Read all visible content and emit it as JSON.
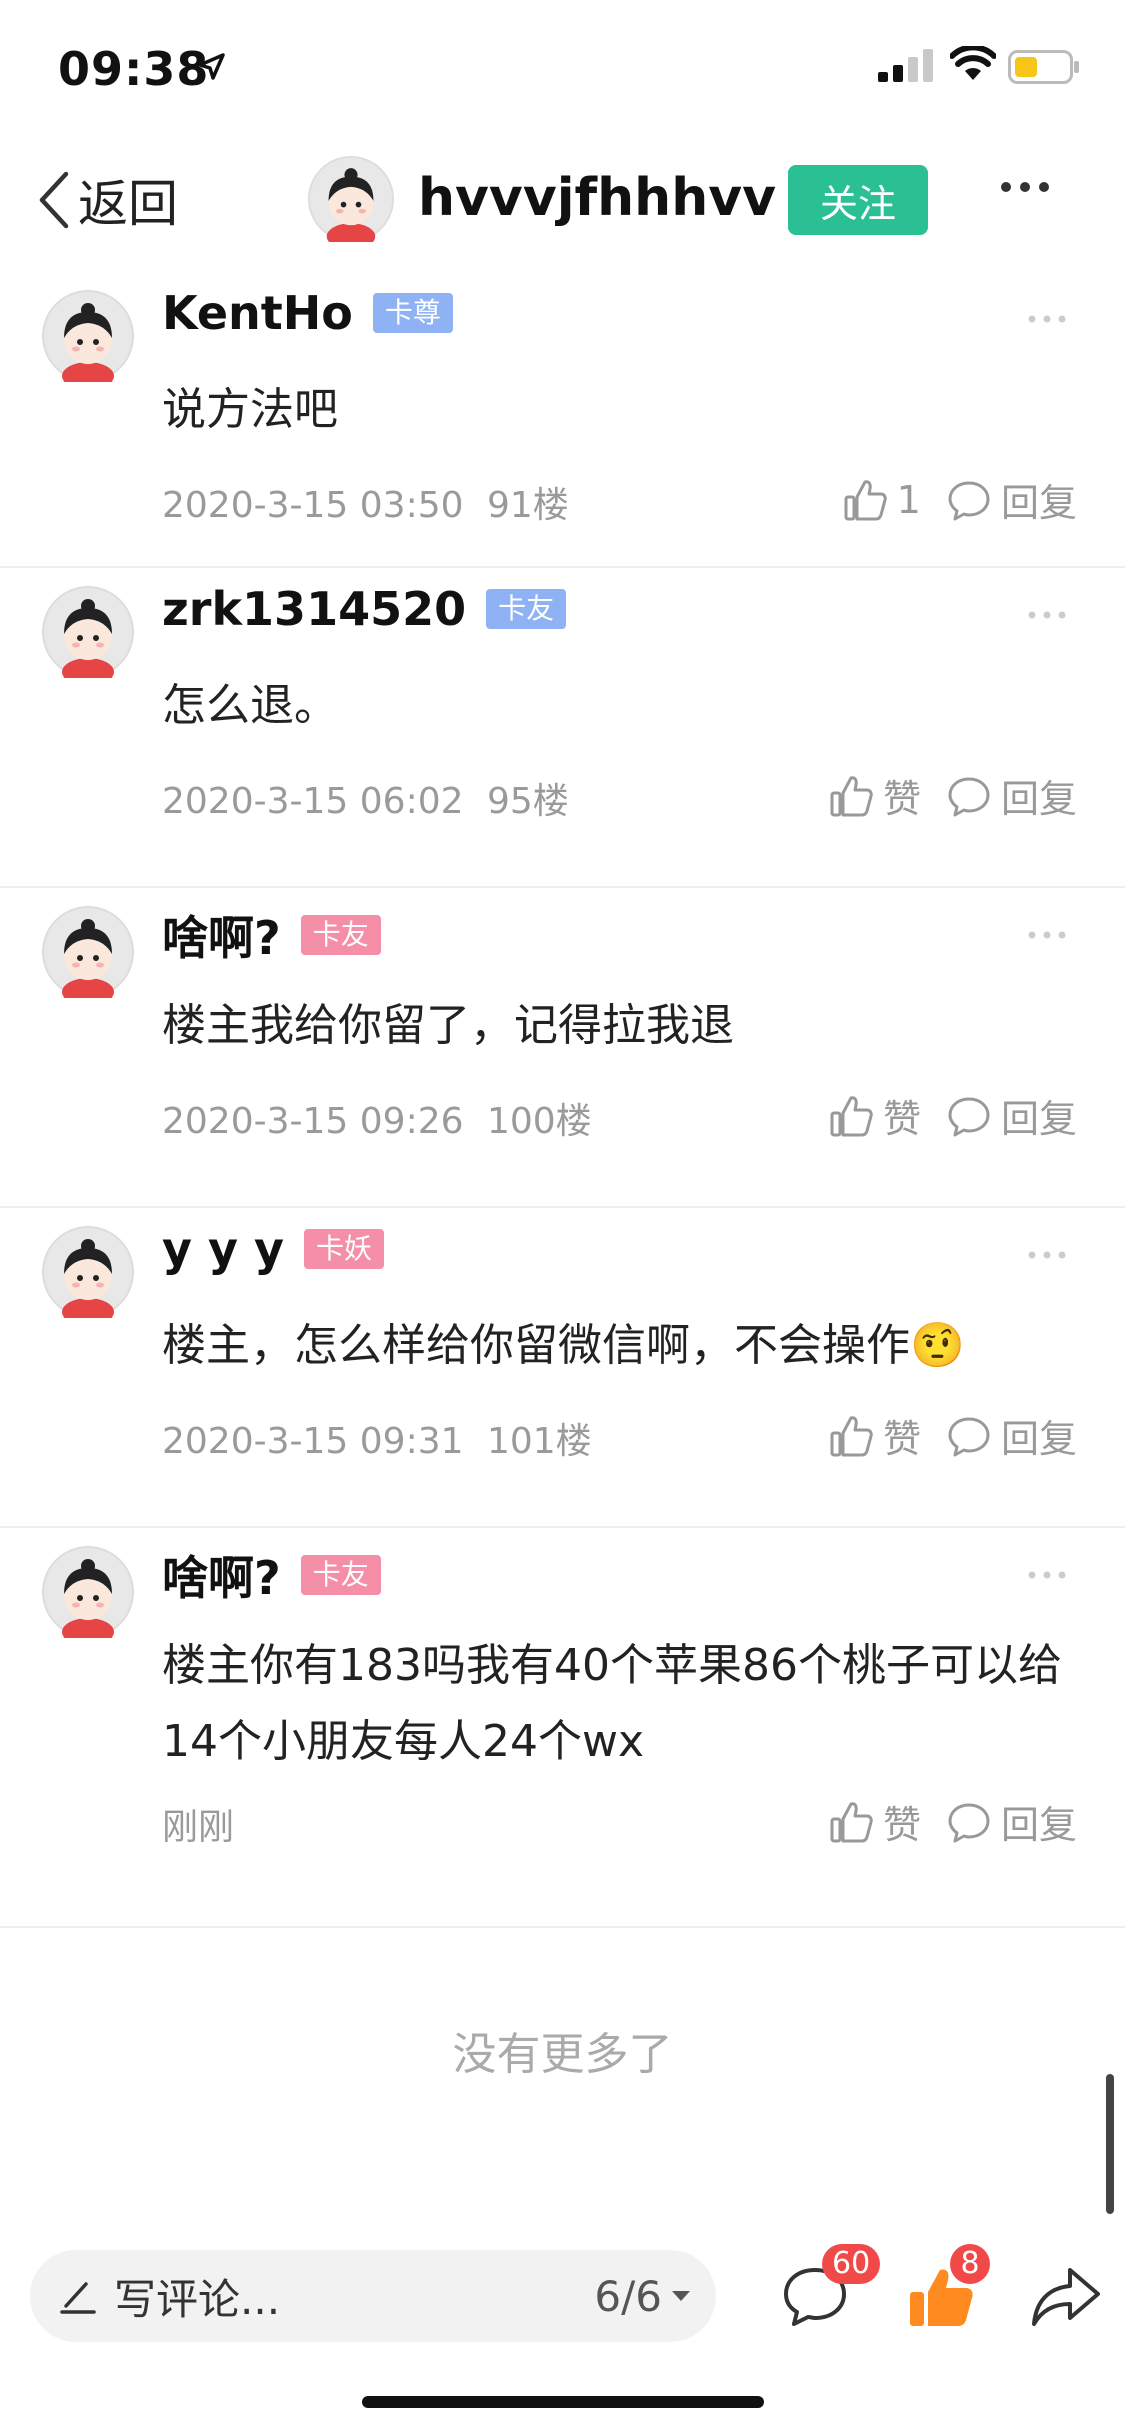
{
  "status_bar": {
    "time": "09:38"
  },
  "nav": {
    "back_label": "返回",
    "title": "hvvvjfhhhvv",
    "follow_label": "关注"
  },
  "colors": {
    "follow_green": "#2bbf94",
    "badge_blue": "#8fb2f5",
    "badge_pink": "#f58fa8",
    "like_orange": "#ff8a1f",
    "notify_red": "#f14848"
  },
  "comments": [
    {
      "author": "KentHo",
      "badge": "卡尊",
      "badge_color": "#8fb2f5",
      "text": "说方法吧",
      "time": "2020-3-15 03:50",
      "floor": "91楼",
      "like_label": "1",
      "reply_label": "回复"
    },
    {
      "author": "zrk1314520",
      "badge": "卡友",
      "badge_color": "#8fb2f5",
      "text": "怎么退。",
      "time": "2020-3-15 06:02",
      "floor": "95楼",
      "like_label": "赞",
      "reply_label": "回复"
    },
    {
      "author": "啥啊?",
      "badge": "卡友",
      "badge_color": "#f58fa8",
      "text": "楼主我给你留了，记得拉我退",
      "time": "2020-3-15 09:26",
      "floor": "100楼",
      "like_label": "赞",
      "reply_label": "回复"
    },
    {
      "author": "y y y",
      "badge": "卡妖",
      "badge_color": "#f58fa8",
      "text": "楼主，怎么样给你留微信啊，不会操作🤨",
      "time": "2020-3-15 09:31",
      "floor": "101楼",
      "like_label": "赞",
      "reply_label": "回复"
    },
    {
      "author": "啥啊?",
      "badge": "卡友",
      "badge_color": "#f58fa8",
      "text": "楼主你有183吗我有40个苹果86个桃子可以给14个小朋友每人24个wx",
      "time": "刚刚",
      "floor": "",
      "like_label": "赞",
      "reply_label": "回复"
    }
  ],
  "footer": {
    "no_more": "没有更多了"
  },
  "bottom_bar": {
    "placeholder": "写评论...",
    "page_indicator": "6/6",
    "comment_count": "60",
    "like_count": "8"
  }
}
